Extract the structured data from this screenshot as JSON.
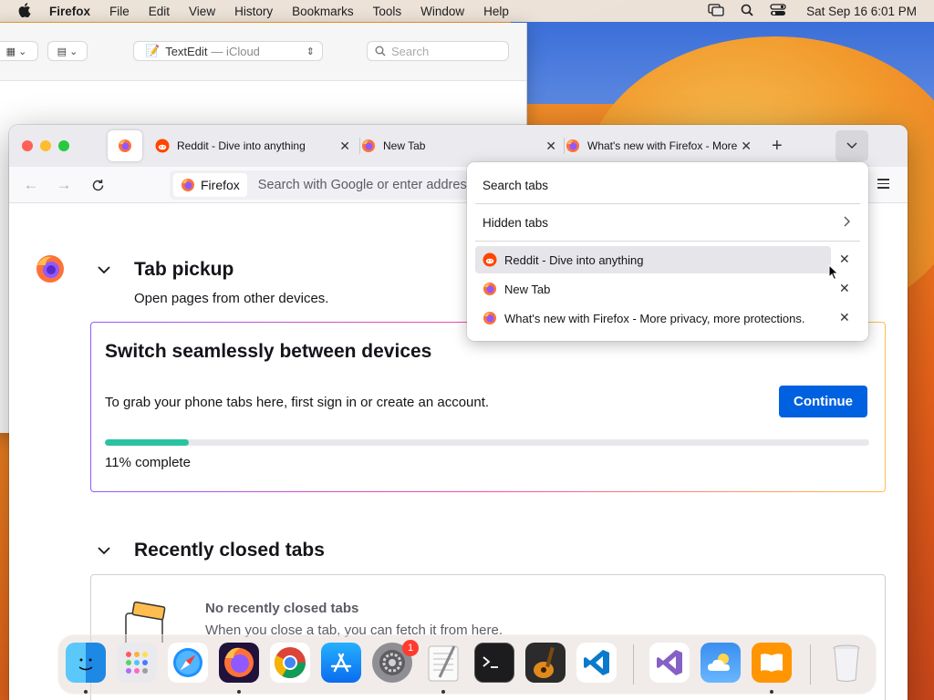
{
  "menubar": {
    "items": [
      "Firefox",
      "File",
      "Edit",
      "View",
      "History",
      "Bookmarks",
      "Tools",
      "Window",
      "Help"
    ],
    "clock": "Sat Sep 16  6:01 PM"
  },
  "textedit": {
    "doc_name": "TextEdit",
    "doc_location": "— iCloud",
    "search_placeholder": "Search"
  },
  "tabs": [
    {
      "label": "Reddit - Dive into anything",
      "icon": "reddit-icon"
    },
    {
      "label": "New Tab",
      "icon": "firefox-icon"
    },
    {
      "label": "What's new with Firefox - More",
      "icon": "firefox-icon"
    }
  ],
  "urlbar": {
    "chip_label": "Firefox",
    "placeholder": "Search with Google or enter address"
  },
  "content": {
    "tab_pickup_title": "Tab pickup",
    "tab_pickup_sub": "Open pages from other devices.",
    "card_title": "Switch seamlessly between devices",
    "card_text": "To grab your phone tabs here, first sign in or create an account.",
    "continue_label": "Continue",
    "progress_percent": 11,
    "progress_label": "11% complete",
    "recently_closed_title": "Recently closed tabs",
    "no_closed_title": "No recently closed tabs",
    "no_closed_sub": "When you close a tab, you can fetch it from here."
  },
  "panel": {
    "search_label": "Search tabs",
    "hidden_label": "Hidden tabs",
    "rows": [
      {
        "label": "Reddit - Dive into anything",
        "icon": "reddit-icon"
      },
      {
        "label": "New Tab",
        "icon": "firefox-icon"
      },
      {
        "label": "What's new with Firefox - More privacy, more protections.",
        "icon": "firefox-icon"
      }
    ]
  },
  "dock": {
    "apps": [
      "Finder",
      "Launchpad",
      "Safari",
      "Firefox",
      "Chrome",
      "App Store",
      "System Settings",
      "TextEdit",
      "Terminal",
      "GarageBand",
      "VS Code",
      "Visual Studio",
      "Weather",
      "Books",
      "Trash"
    ],
    "settings_badge": "1"
  },
  "colors": {
    "accent_blue": "#0061e0",
    "progress_green": "#2ac3a2",
    "tab_bar": "#ebeaee"
  }
}
